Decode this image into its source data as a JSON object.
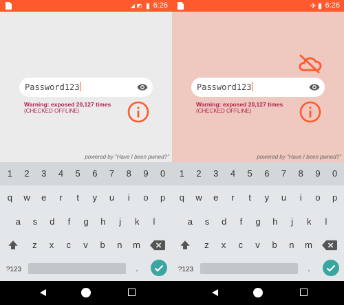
{
  "status_bar": {
    "time": "6:26"
  },
  "app": {
    "password_value": "Password123",
    "warning": "Warning: exposed 20,127 times",
    "offline_note": "(CHECKED OFFLINE)",
    "powered_by": "powered by \"Have I been pwned?\""
  },
  "keyboard": {
    "numbers": [
      "1",
      "2",
      "3",
      "4",
      "5",
      "6",
      "7",
      "8",
      "9",
      "0"
    ],
    "row1": [
      "q",
      "w",
      "e",
      "r",
      "t",
      "y",
      "u",
      "i",
      "o",
      "p"
    ],
    "row2": [
      "a",
      "s",
      "d",
      "f",
      "g",
      "h",
      "j",
      "k",
      "l"
    ],
    "row3": [
      "z",
      "x",
      "c",
      "v",
      "b",
      "n",
      "m"
    ],
    "symbols_key": "?123",
    "period_key": "."
  },
  "colors": {
    "accent": "#ff5a2e",
    "warning_text": "#b0204e",
    "enter_key": "#3aa6a0"
  },
  "icons": {
    "visibility": "eye-icon",
    "info": "info-icon",
    "offline": "cloud-off-icon",
    "shift": "shift-icon",
    "backspace": "backspace-icon",
    "enter": "check-icon"
  }
}
